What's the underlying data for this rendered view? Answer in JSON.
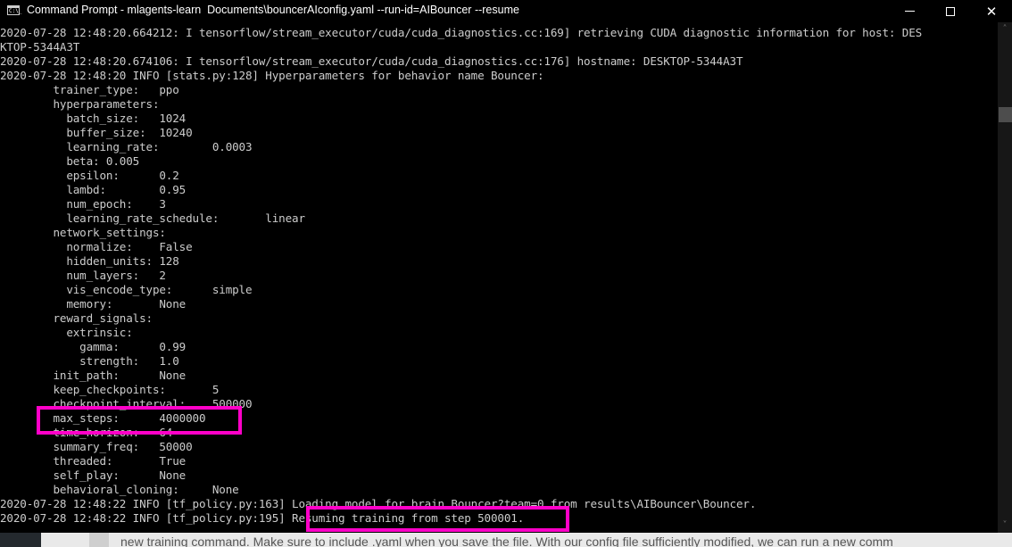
{
  "window": {
    "title": "Command Prompt - mlagents-learn  Documents\\bouncerAIconfig.yaml --run-id=AIBouncer --resume",
    "icon_label": "C:\\_",
    "controls": {
      "minimize": "minimize",
      "maximize": "maximize",
      "close": "✕"
    }
  },
  "console": {
    "lines": [
      "2020-07-28 12:48:20.664212: I tensorflow/stream_executor/cuda/cuda_diagnostics.cc:169] retrieving CUDA diagnostic information for host: DES",
      "KTOP-5344A3T",
      "2020-07-28 12:48:20.674106: I tensorflow/stream_executor/cuda/cuda_diagnostics.cc:176] hostname: DESKTOP-5344A3T",
      "2020-07-28 12:48:20 INFO [stats.py:128] Hyperparameters for behavior name Bouncer:",
      "        trainer_type:   ppo",
      "        hyperparameters:",
      "          batch_size:   1024",
      "          buffer_size:  10240",
      "          learning_rate:        0.0003",
      "          beta: 0.005",
      "          epsilon:      0.2",
      "          lambd:        0.95",
      "          num_epoch:    3",
      "          learning_rate_schedule:       linear",
      "        network_settings:",
      "          normalize:    False",
      "          hidden_units: 128",
      "          num_layers:   2",
      "          vis_encode_type:      simple",
      "          memory:       None",
      "        reward_signals:",
      "          extrinsic:",
      "            gamma:      0.99",
      "            strength:   1.0",
      "        init_path:      None",
      "        keep_checkpoints:       5",
      "        checkpoint_interval:    500000",
      "        max_steps:      4000000",
      "        time_horizon:   64",
      "        summary_freq:   50000",
      "        threaded:       True",
      "        self_play:      None",
      "        behavioral_cloning:     None",
      "2020-07-28 12:48:22 INFO [tf_policy.py:163] Loading model for brain Bouncer?team=0 from results\\AIBouncer\\Bouncer.",
      "2020-07-28 12:48:22 INFO [tf_policy.py:195] Resuming training from step 500001."
    ]
  },
  "scrollbar": {
    "up": "˄",
    "down": "˅",
    "position": 0.15
  },
  "annotations": {
    "color": "#ff00c8",
    "highlight_1": "max_steps:      4000000",
    "highlight_2": "Resuming training from step 500001."
  },
  "background_page": {
    "text": "new training command. Make sure to include .yaml when you save the file. With our config file sufficiently modified, we can run a new comm"
  }
}
